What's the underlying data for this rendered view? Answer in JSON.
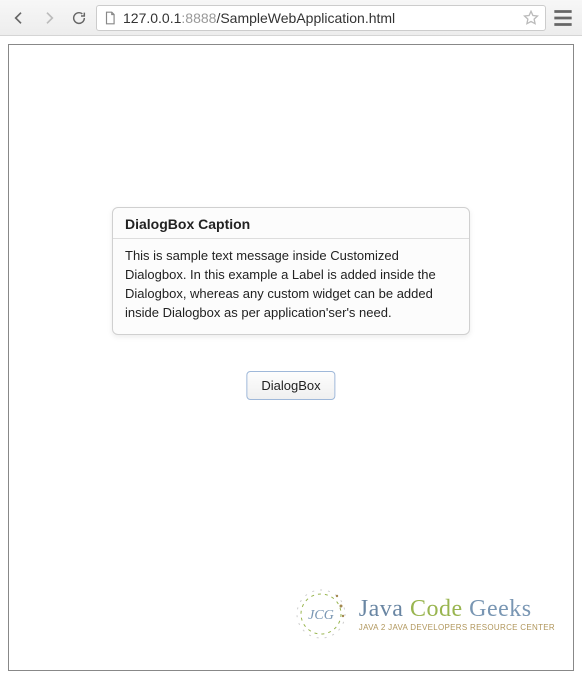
{
  "browser": {
    "url_host": "127.0.0.1",
    "url_port": ":8888",
    "url_path": "/SampleWebApplication.html"
  },
  "dialog": {
    "caption": "DialogBox Caption",
    "body": "This is sample text message inside Customized Dialogbox. In this example a Label is added inside the Dialogbox, whereas any custom widget can be added inside Dialogbox as per application'ser's need."
  },
  "button": {
    "label": "DialogBox"
  },
  "logo": {
    "word1": "Java",
    "word2": "Code",
    "word3": "Geeks",
    "tagline": "Java 2 Java Developers Resource Center"
  }
}
